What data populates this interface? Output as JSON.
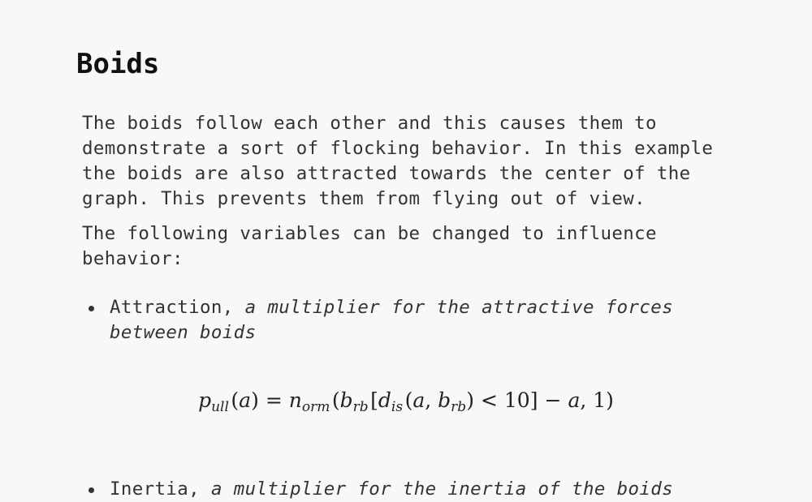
{
  "heading": "Boids",
  "paragraphs": [
    "The boids follow each other and this causes them to demonstrate a sort of flocking behavior. In this example the boids are also attracted towards the center of the graph. This prevents them from flying out of view.",
    "The following variables can be changed to influence behavior:"
  ],
  "variables": [
    {
      "name": "Attraction,",
      "description": "a multiplier for the attractive forces between boids"
    },
    {
      "name": "Inertia,",
      "description": "a multiplier for the inertia of the boids"
    }
  ],
  "formula": {
    "lhs_symbol": "p",
    "lhs_sub": "ull",
    "arg": "a",
    "equals": "=",
    "fn_symbol": "n",
    "fn_sub": "orm",
    "b_symbol": "b",
    "b_sub": "rb",
    "d_symbol": "d",
    "d_sub": "is",
    "lt": "<",
    "threshold": "10",
    "minus": "−",
    "one": "1"
  }
}
